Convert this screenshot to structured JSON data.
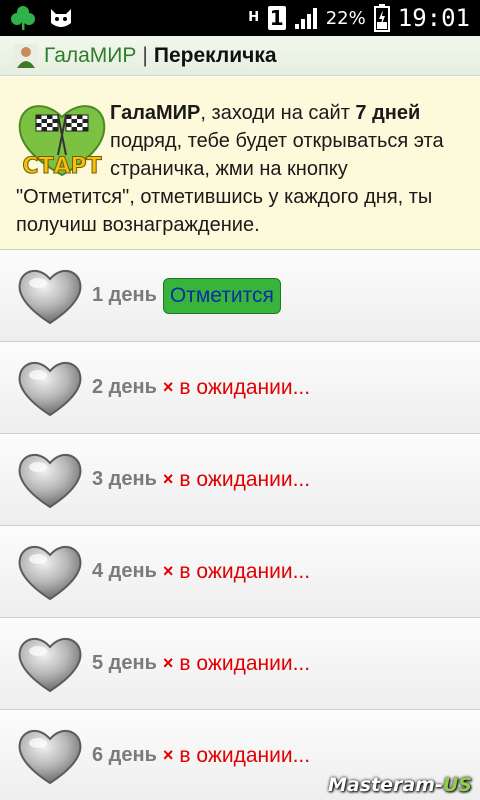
{
  "status_bar": {
    "icons": [
      "clover-icon",
      "cat-icon"
    ],
    "network_h": "H",
    "sim": "1",
    "battery_pct": "22%",
    "time": "19:01"
  },
  "header": {
    "site": "ГалаМИР",
    "separator": "|",
    "title": "Перекличка"
  },
  "info": {
    "site_bold": "ГалаМИР",
    "text_1": ", заходи на сайт ",
    "days_bold": "7 дней",
    "text_2": " подряд, тебе будет открываться эта страничка, жми на кнопку \"Отметится\", отметившись у каждого дня, ты получиш вознаграждение.",
    "logo_text": "СТАРТ"
  },
  "days": [
    {
      "label": "1 день",
      "state": "button",
      "button_label": "Отметится"
    },
    {
      "label": "2 день",
      "state": "waiting",
      "mark": "×",
      "status": "в ожидании..."
    },
    {
      "label": "3 день",
      "state": "waiting",
      "mark": "×",
      "status": "в ожидании..."
    },
    {
      "label": "4 день",
      "state": "waiting",
      "mark": "×",
      "status": "в ожидании..."
    },
    {
      "label": "5 день",
      "state": "waiting",
      "mark": "×",
      "status": "в ожидании..."
    },
    {
      "label": "6 день",
      "state": "waiting",
      "mark": "×",
      "status": "в ожидании..."
    }
  ],
  "watermark": {
    "main": "Masteram-",
    "suffix": "US"
  },
  "colors": {
    "accent_green": "#38b43c",
    "site_green": "#2f7d2f",
    "waiting_red": "#e00000",
    "info_bg": "#fdf9db"
  }
}
